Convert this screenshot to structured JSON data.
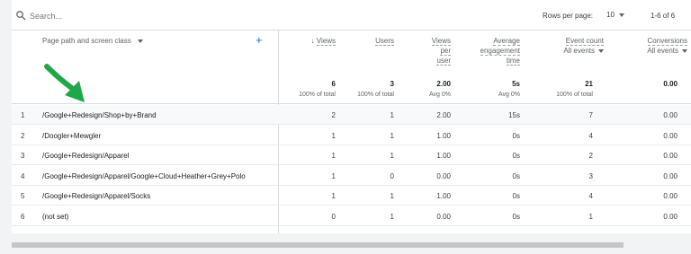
{
  "toolbar": {
    "search_placeholder": "Search...",
    "rows_per_page_label": "Rows per page:",
    "rows_per_page_value": "10",
    "range": "1-6 of 6"
  },
  "header": {
    "dimension": "Page path and screen class",
    "columns": [
      {
        "label": "Views",
        "sorted": true,
        "sub": ""
      },
      {
        "label": "Users",
        "sub": ""
      },
      {
        "label_lines": [
          "Views",
          "per",
          "user"
        ],
        "sub": ""
      },
      {
        "label_lines": [
          "Average",
          "engagement",
          "time"
        ],
        "sub": ""
      },
      {
        "label": "Event count",
        "sub": "All events"
      },
      {
        "label": "Conversions",
        "sub": "All events"
      }
    ]
  },
  "totals": [
    {
      "value": "6",
      "sub": "100% of total"
    },
    {
      "value": "3",
      "sub": "100% of total"
    },
    {
      "value": "2.00",
      "sub": "Avg 0%"
    },
    {
      "value": "5s",
      "sub": "Avg 0%"
    },
    {
      "value": "21",
      "sub": "100% of total"
    },
    {
      "value": "0.00",
      "sub": ""
    }
  ],
  "rows": [
    {
      "index": "1",
      "path": "/Google+Redesign/Shop+by+Brand",
      "views": "2",
      "users": "1",
      "vpu": "2.00",
      "aet": "15s",
      "events": "7",
      "conversions": "0.00"
    },
    {
      "index": "2",
      "path": "/Doogler+Mewgler",
      "views": "1",
      "users": "1",
      "vpu": "1.00",
      "aet": "0s",
      "events": "4",
      "conversions": "0.00"
    },
    {
      "index": "3",
      "path": "/Google+Redesign/Apparel",
      "views": "1",
      "users": "1",
      "vpu": "1.00",
      "aet": "0s",
      "events": "2",
      "conversions": "0.00"
    },
    {
      "index": "4",
      "path": "/Google+Redesign/Apparel/Google+Cloud+Heather+Grey+Polo",
      "views": "1",
      "users": "0",
      "vpu": "0.00",
      "aet": "0s",
      "events": "3",
      "conversions": "0.00"
    },
    {
      "index": "5",
      "path": "/Google+Redesign/Apparel/Socks",
      "views": "1",
      "users": "1",
      "vpu": "1.00",
      "aet": "0s",
      "events": "4",
      "conversions": "0.00"
    },
    {
      "index": "6",
      "path": "(not set)",
      "views": "0",
      "users": "1",
      "vpu": "0.00",
      "aet": "0s",
      "events": "1",
      "conversions": "0.00"
    }
  ],
  "icons": {
    "search": "search-icon",
    "add": "plus-icon",
    "sort": "arrow-down-icon",
    "dropdown": "caret-down-icon",
    "annotation": "green-arrow-icon"
  },
  "colors": {
    "accent": "#1a73e8",
    "annotation_arrow": "#1fa84a"
  }
}
